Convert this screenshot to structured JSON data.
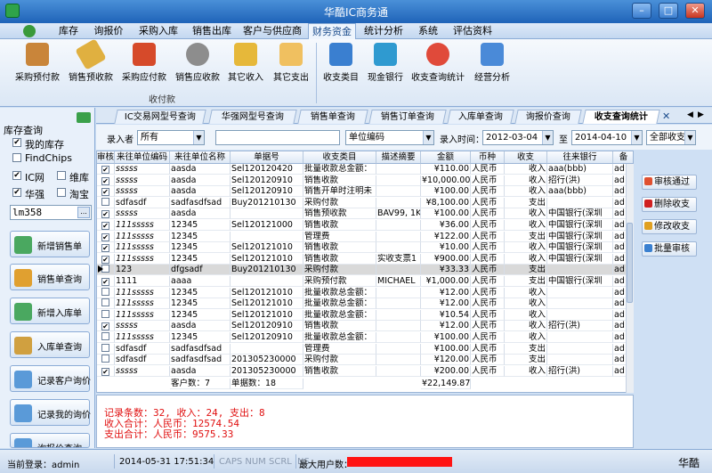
{
  "window": {
    "title": "华酷IC商务通",
    "controls": [
      "–",
      "□",
      "✕"
    ]
  },
  "menu": [
    "库存",
    "询报价",
    "采购入库",
    "销售出库",
    "客户与供应商",
    "财务资金",
    "统计分析",
    "系统",
    "评估资料"
  ],
  "ribbon": {
    "group1_label": "收付款",
    "buttons": [
      "采购预付款",
      "销售预收款",
      "采购应付款",
      "销售应收款",
      "其它收入",
      "其它支出",
      "收支类目",
      "现金银行",
      "收支查询统计",
      "经营分析"
    ]
  },
  "left_panel": {
    "title": "库存查询",
    "checks": [
      {
        "label": "我的库存",
        "checked": true
      },
      {
        "label": "FindChips",
        "checked": false
      },
      {
        "label": "IC网",
        "checked": true
      },
      {
        "label": "维库",
        "checked": false
      },
      {
        "label": "华强",
        "checked": true
      },
      {
        "label": "淘宝",
        "checked": false
      }
    ],
    "search_value": "lm358",
    "search_button": "...",
    "nav": [
      "新增销售单",
      "销售单查询",
      "新增入库单",
      "入库单查询",
      "记录客户询价",
      "记录我的询价",
      "询报价查询"
    ]
  },
  "doc_tabs": [
    "IC交易网型号查询",
    "华强网型号查询",
    "销售单查询",
    "销售订单查询",
    "入库单查询",
    "询报价查询",
    "收支查询统计"
  ],
  "filter": {
    "entrant_label": "录入者",
    "entrant_value": "所有",
    "unit_combo": "单位编码",
    "time_label": "录入时间：",
    "date_from": "2012-03-04",
    "to_label": "至",
    "date_to": "2014-04-10",
    "type_combo": "全部收支"
  },
  "grid": {
    "headers": [
      "审核",
      "来往单位编码",
      "来往单位名称",
      "单据号",
      "收支类目",
      "描述摘要",
      "金额",
      "币种",
      "收支",
      "往来银行",
      "备"
    ],
    "rows": [
      [
        "✔",
        "sssss",
        "aasda",
        "Sel120120420",
        "批量收款总金额：",
        "",
        "¥110.00",
        "人民币",
        "收入",
        "aaa(bbb)",
        "ad"
      ],
      [
        "✔",
        "sssss",
        "aasda",
        "Sel120120910",
        "销售收款",
        "",
        "¥10,000.00",
        "人民币",
        "收入",
        "招行(洪)",
        "ad"
      ],
      [
        "✔",
        "sssss",
        "aasda",
        "Sel120120910",
        "销售开单时注明未",
        "",
        "¥100.00",
        "人民币",
        "收入",
        "aaa(bbb)",
        "ad"
      ],
      [
        "",
        "sdfasdf",
        "sadfasdfsad",
        "Buy201210130",
        "采购付款",
        "",
        "¥8,100.00",
        "人民币",
        "支出",
        "",
        "ad"
      ],
      [
        "✔",
        "sssss",
        "aasda",
        "",
        "销售预收款",
        "BAV99, 1K",
        "¥100.00",
        "人民币",
        "收入",
        "中国银行(深圳",
        "ad"
      ],
      [
        "✔",
        "111sssss",
        "12345",
        "Sel120121000",
        "销售收款",
        "",
        "¥36.00",
        "人民币",
        "收入",
        "中国银行(深圳",
        "ad"
      ],
      [
        "✔",
        "111sssss",
        "12345",
        "",
        "管理费",
        "",
        "¥122.00",
        "人民币",
        "支出",
        "中国银行(深圳",
        "ad"
      ],
      [
        "✔",
        "111sssss",
        "12345",
        "Sel120121010",
        "销售收款",
        "",
        "¥10.00",
        "人民币",
        "收入",
        "中国银行(深圳",
        "ad"
      ],
      [
        "✔",
        "111sssss",
        "12345",
        "Sel120121010",
        "销售收款",
        "实收支票1",
        "¥900.00",
        "人民币",
        "收入",
        "中国银行(深圳",
        "ad"
      ],
      [
        "",
        "123",
        "dfgsadf",
        "Buy201210130",
        "采购付款",
        "",
        "¥33.33",
        "人民币",
        "支出",
        "",
        "ad"
      ],
      [
        "✔",
        "1111",
        "aaaa",
        "",
        "采购预付款",
        "MICHAEL",
        "¥1,000.00",
        "人民币",
        "支出",
        "中国银行(深圳",
        "ad"
      ],
      [
        "",
        "111sssss",
        "12345",
        "Sel120121010",
        "批量收款总金额：",
        "",
        "¥12.00",
        "人民币",
        "收入",
        "",
        "ad"
      ],
      [
        "",
        "111sssss",
        "12345",
        "Sel120121010",
        "批量收款总金额：",
        "",
        "¥12.00",
        "人民币",
        "收入",
        "",
        "ad"
      ],
      [
        "",
        "111sssss",
        "12345",
        "Sel120121010",
        "批量收款总金额：",
        "",
        "¥10.54",
        "人民币",
        "收入",
        "",
        "ad"
      ],
      [
        "✔",
        "sssss",
        "aasda",
        "Sel120120910",
        "销售收款",
        "",
        "¥12.00",
        "人民币",
        "收入",
        "招行(洪)",
        "ad"
      ],
      [
        "",
        "111sssss",
        "12345",
        "Sel120120910",
        "批量收款总金额：",
        "",
        "¥100.00",
        "人民币",
        "收入",
        "",
        "ad"
      ],
      [
        "",
        "sdfasdf",
        "sadfasdfsad",
        "",
        "管理费",
        "",
        "¥100.00",
        "人民币",
        "支出",
        "",
        "ad"
      ],
      [
        "",
        "sdfasdf",
        "sadfasdfsad",
        "201305230000",
        "采购付款",
        "",
        "¥120.00",
        "人民币",
        "支出",
        "",
        "ad"
      ],
      [
        "✔",
        "sssss",
        "aasda",
        "201305230000",
        "销售收款",
        "",
        "¥200.00",
        "人民币",
        "收入",
        "招行(洪)",
        "ad"
      ]
    ],
    "footer": {
      "customers": "客户数：7",
      "docs": "单据数：18",
      "total": "¥22,149.87"
    }
  },
  "actions": [
    "审核通过",
    "删除收支",
    "修改收支",
    "批量审核"
  ],
  "summary": [
    "记录条数：32, 收入：24, 支出：8",
    "收入合计：人民币：12574.54",
    "支出合计：人民币：9575.33"
  ],
  "status": {
    "login": "当前登录：admin",
    "datetime": "2014-05-31 17:51:34",
    "keys": "CAPS NUM SCRL INS",
    "max_users": "最大用户数：",
    "brand": "华酷"
  },
  "colors": {
    "accent": "#1f63b8",
    "summary_text": "#e01010",
    "redaction": "#ff1414"
  }
}
